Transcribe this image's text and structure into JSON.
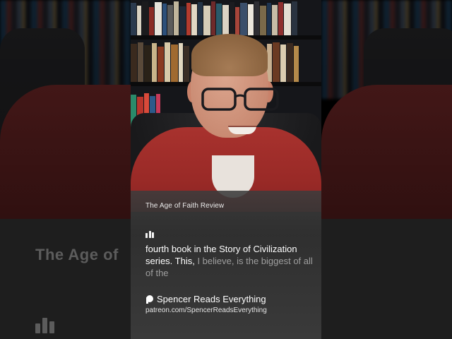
{
  "background": {
    "title_echo": "The Age of"
  },
  "panel": {
    "title": "The Age of Faith Review",
    "caption_spoken": "fourth book in the Story of Civilization series. This,",
    "caption_pending": " I believe, is the biggest of all of the",
    "credit_name": "Spencer Reads Everything",
    "credit_url": "patreon.com/SpencerReadsEverything"
  },
  "icons": {
    "transcript": "bar-chart-icon",
    "credit": "patreon-icon"
  },
  "colors": {
    "shirt": "#a8322e",
    "panel": "#3a3a3a",
    "caption_pending": "#9e9e9e"
  }
}
